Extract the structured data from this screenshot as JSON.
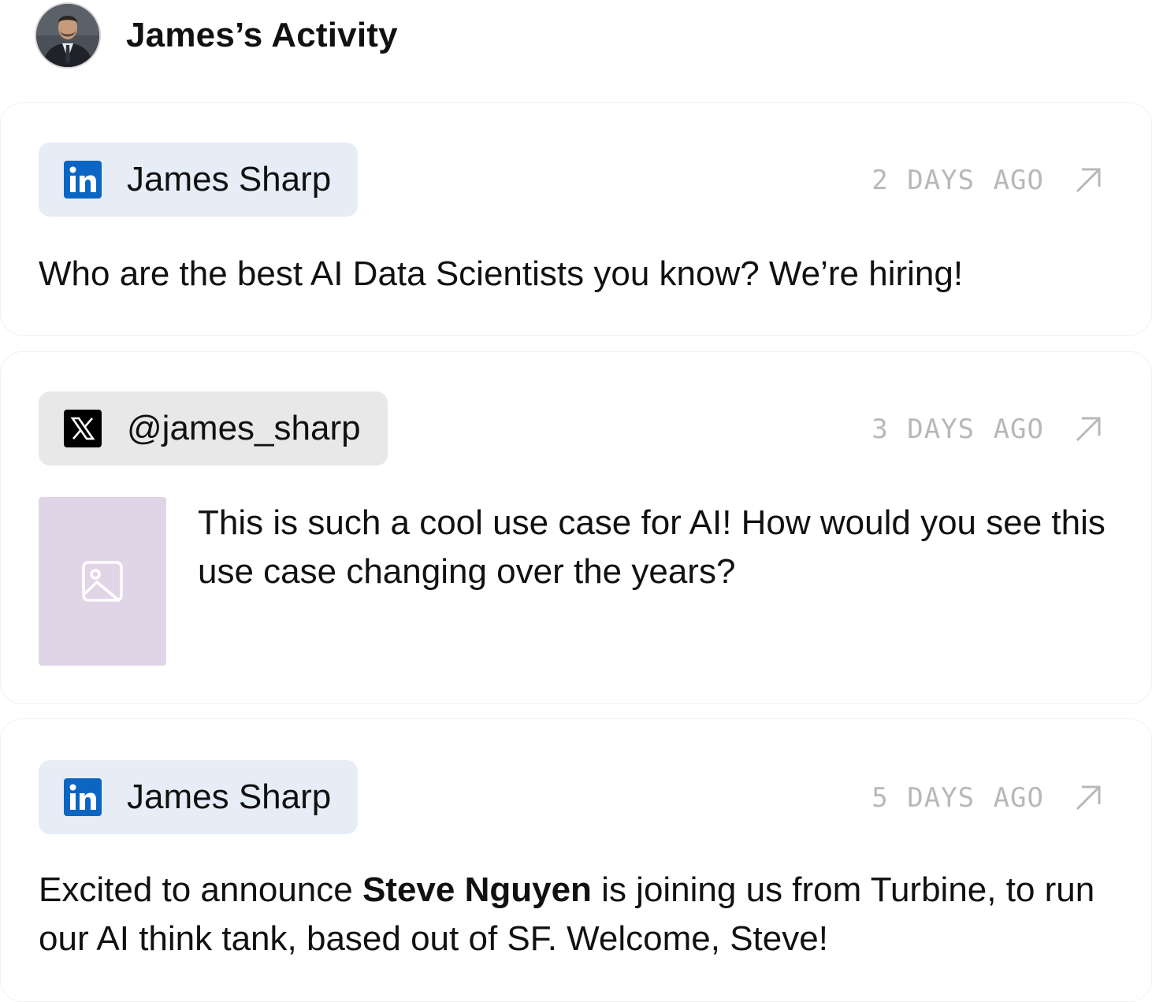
{
  "header": {
    "title": "James’s Activity",
    "avatar_icon": "person-avatar-icon"
  },
  "posts": [
    {
      "platform": "linkedin",
      "platform_icon": "linkedin-icon",
      "author": "James Sharp",
      "time": "2 DAYS AGO",
      "open_icon": "arrow-up-right-icon",
      "text": "Who are the best AI Data Scientists you know? We’re hiring!"
    },
    {
      "platform": "x",
      "platform_icon": "x-icon",
      "author": "@james_sharp",
      "time": "3 DAYS AGO",
      "open_icon": "arrow-up-right-icon",
      "thumbnail_icon": "image-placeholder-icon",
      "text": "This is such a cool use case for AI! How would you see this use case changing over the years?"
    },
    {
      "platform": "linkedin",
      "platform_icon": "linkedin-icon",
      "author": "James Sharp",
      "time": "5 DAYS AGO",
      "open_icon": "arrow-up-right-icon",
      "text_before": "Excited to announce ",
      "text_bold": "Steve Nguyen",
      "text_after": " is joining us from Turbine, to run our AI think tank, based out of SF. Welcome, Steve!"
    }
  ],
  "colors": {
    "linkedin_blue": "#0a66c2",
    "linkedin_pill_bg": "#e6edf7",
    "x_pill_bg": "#e8e8e8",
    "timestamp_gray": "#b8b8b8",
    "thumbnail_bg": "#e0d5e7"
  }
}
